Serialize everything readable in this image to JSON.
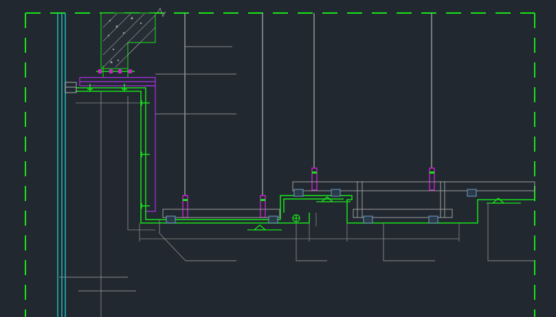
{
  "drawing": {
    "background": "#212830",
    "layer_colors": {
      "border": "#19e619",
      "structure": "#19e619",
      "frame": "#9a2fd1",
      "hanger": "#cc22cc",
      "curtain_wall": "#1ec8c8",
      "leader": "#8c8c8c",
      "clip": "#6fa0c8",
      "hatch": "#9aa0a0"
    },
    "labels": []
  }
}
